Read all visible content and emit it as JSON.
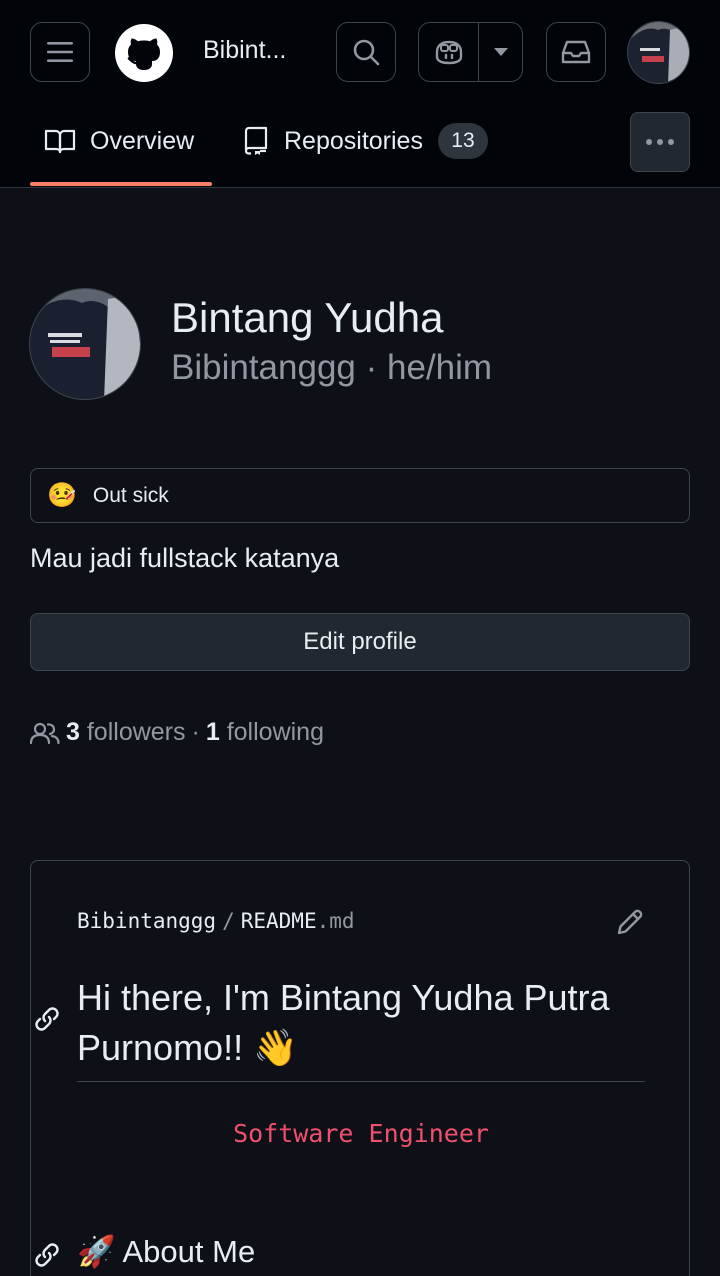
{
  "header": {
    "username": "Bibint...",
    "icons": {
      "menu": "hamburger-icon",
      "logo": "github-logo",
      "search": "search-icon",
      "copilot": "copilot-icon",
      "caret": "caret-down-icon",
      "inbox": "inbox-icon"
    }
  },
  "tabs": [
    {
      "label": "Overview",
      "icon": "book-icon",
      "selected": true
    },
    {
      "label": "Repositories",
      "icon": "repo-icon",
      "count": "13"
    }
  ],
  "profile": {
    "name": "Bintang Yudha",
    "login": "Bibintanggg",
    "pronouns": "he/him",
    "separator": "·",
    "status_emoji": "🤒",
    "status_text": "Out sick",
    "bio": "Mau jadi fullstack katanya",
    "edit_label": "Edit profile",
    "followers_count": "3",
    "followers_label": "followers",
    "following_count": "1",
    "following_label": "following",
    "dot": "·"
  },
  "readme": {
    "owner": "Bibintanggg",
    "slash": "/",
    "filename": "README",
    "extension": ".md",
    "heading": "Hi there, I'm Bintang Yudha Putra Purnomo!! 👋",
    "role": "Software Engineer",
    "section_heading": "🚀 About Me"
  },
  "colors": {
    "background": "#0d1117",
    "header_bg": "#010409",
    "border": "#3d444d",
    "tab_underline": "#f78166",
    "muted_text": "#9198a1",
    "role_text": "#f0506e"
  }
}
